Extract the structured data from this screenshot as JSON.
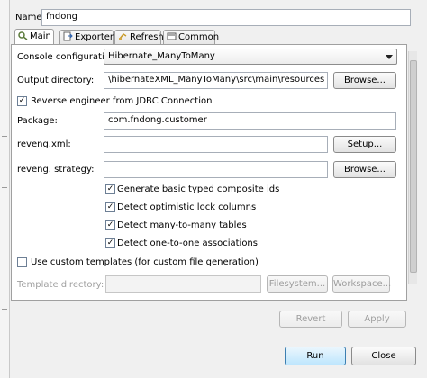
{
  "name": {
    "label": "Name:",
    "value": "fndong"
  },
  "tabs": [
    {
      "label": "Main",
      "active": true,
      "icon": "main-config-icon"
    },
    {
      "label": "Exporters",
      "active": false,
      "icon": "exporters-icon"
    },
    {
      "label": "Refresh",
      "active": false,
      "icon": "refresh-icon"
    },
    {
      "label": "Common",
      "active": false,
      "icon": "common-icon"
    }
  ],
  "main": {
    "console_configuration": {
      "label": "Console configuration:",
      "value": "Hibernate_ManyToMany"
    },
    "output_directory": {
      "label": "Output directory:",
      "value": "\\hibernateXML_ManyToMany\\src\\main\\resources",
      "button": "Browse..."
    },
    "reverse_engineer": {
      "label": "Reverse engineer from JDBC Connection",
      "checked": true
    },
    "package": {
      "label": "Package:",
      "value": "com.fndong.customer"
    },
    "reveng_xml": {
      "label": "reveng.xml:",
      "value": "",
      "button": "Setup..."
    },
    "reveng_strategy": {
      "label": "reveng. strategy:",
      "value": "",
      "button": "Browse..."
    },
    "options": [
      {
        "label": "Generate basic typed composite ids",
        "checked": true
      },
      {
        "label": "Detect optimistic lock columns",
        "checked": true
      },
      {
        "label": "Detect many-to-many tables",
        "checked": true
      },
      {
        "label": "Detect one-to-one associations",
        "checked": true
      }
    ],
    "custom_templates": {
      "label": "Use custom templates (for custom file generation)",
      "checked": false
    },
    "template_directory": {
      "label": "Template directory:",
      "value": "",
      "filesystem_button": "Filesystem...",
      "workspace_button": "Workspace..."
    }
  },
  "footer": {
    "revert": "Revert",
    "apply": "Apply",
    "run": "Run",
    "close": "Close"
  },
  "colors": {
    "panel_border": "#a0a0a0",
    "primary_button": "#bee6fd",
    "check_mark": "#000000"
  }
}
